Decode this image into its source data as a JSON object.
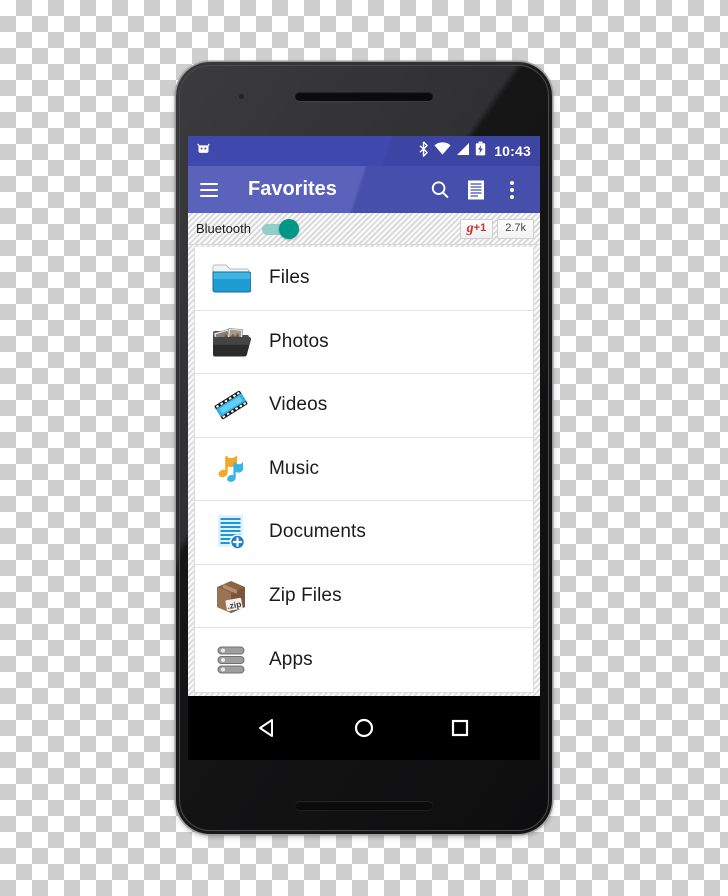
{
  "status_bar": {
    "notification_icon": "android-robot-icon",
    "icons": [
      "bluetooth-icon",
      "wifi-icon",
      "cellular-signal-icon",
      "battery-icon"
    ],
    "clock": "10:43",
    "background_color": "#3f48ad"
  },
  "app_bar": {
    "menu_icon": "hamburger-menu-icon",
    "title": "Favorites",
    "actions": [
      {
        "name": "search-icon",
        "label": "Search"
      },
      {
        "name": "list-view-icon",
        "label": "List view"
      },
      {
        "name": "overflow-menu-icon",
        "label": "More options"
      }
    ],
    "background_color": "#4a53b5"
  },
  "strip": {
    "bluetooth_label": "Bluetooth",
    "bluetooth_toggle_state": "on",
    "toggle_color": "#009688",
    "plusone_g": "g",
    "plusone_plus": "+1",
    "plusone_count": "2.7k",
    "plusone_color": "#c9302c"
  },
  "list": {
    "items": [
      {
        "label": "Files",
        "icon": "blue-folder-icon"
      },
      {
        "label": "Photos",
        "icon": "photo-folder-icon"
      },
      {
        "label": "Videos",
        "icon": "film-strip-icon"
      },
      {
        "label": "Music",
        "icon": "music-notes-icon"
      },
      {
        "label": "Documents",
        "icon": "document-add-icon"
      },
      {
        "label": "Zip Files",
        "icon": "zip-box-icon"
      },
      {
        "label": "Apps",
        "icon": "apps-stack-icon"
      }
    ]
  },
  "nav_bar": {
    "buttons": [
      {
        "name": "back-button",
        "icon": "back-triangle-icon"
      },
      {
        "name": "home-button",
        "icon": "home-circle-icon"
      },
      {
        "name": "recents-button",
        "icon": "recents-square-icon"
      }
    ]
  }
}
